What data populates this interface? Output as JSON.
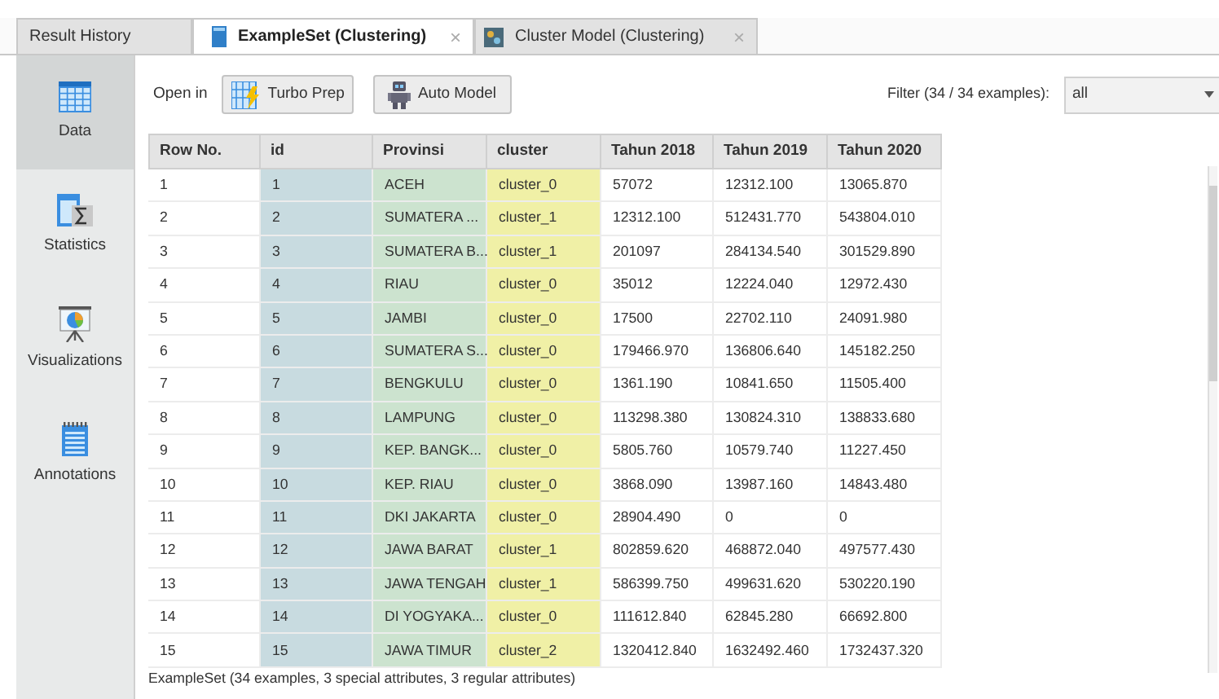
{
  "tabs": [
    {
      "label": "Result History",
      "kind": "plain",
      "selected": false
    },
    {
      "label": "ExampleSet (Clustering)",
      "kind": "table",
      "selected": true,
      "close": "×"
    },
    {
      "label": "Cluster Model (Clustering)",
      "kind": "model",
      "selected": false,
      "close": "×"
    }
  ],
  "sidebar": {
    "items": [
      {
        "label": "Data",
        "kind": "data",
        "selected": true
      },
      {
        "label": "Statistics",
        "kind": "statistics",
        "selected": false
      },
      {
        "label": "Visualizations",
        "kind": "visualizations",
        "selected": false
      },
      {
        "label": "Annotations",
        "kind": "annotations",
        "selected": false
      }
    ]
  },
  "toolbar": {
    "open_in": "Open in",
    "buttons": [
      {
        "label": "Turbo Prep",
        "kind": "turbo"
      },
      {
        "label": "Auto Model",
        "kind": "robot"
      }
    ],
    "filter_label": "Filter (34 / 34 examples):",
    "filter_value": "all"
  },
  "table": {
    "columns": [
      {
        "label": "Row No.",
        "kind": "plain"
      },
      {
        "label": "id",
        "kind": "id"
      },
      {
        "label": "Provinsi",
        "kind": "label"
      },
      {
        "label": "cluster",
        "kind": "cluster"
      },
      {
        "label": "Tahun 2018",
        "kind": "plain"
      },
      {
        "label": "Tahun 2019",
        "kind": "plain"
      },
      {
        "label": "Tahun 2020",
        "kind": "plain"
      }
    ],
    "rows": [
      [
        "1",
        "1",
        "ACEH",
        "cluster_0",
        "57072",
        "12312.100",
        "13065.870"
      ],
      [
        "2",
        "2",
        "SUMATERA ...",
        "cluster_1",
        "12312.100",
        "512431.770",
        "543804.010"
      ],
      [
        "3",
        "3",
        "SUMATERA B...",
        "cluster_1",
        "201097",
        "284134.540",
        "301529.890"
      ],
      [
        "4",
        "4",
        "RIAU",
        "cluster_0",
        "35012",
        "12224.040",
        "12972.430"
      ],
      [
        "5",
        "5",
        "JAMBI",
        "cluster_0",
        "17500",
        "22702.110",
        "24091.980"
      ],
      [
        "6",
        "6",
        "SUMATERA S...",
        "cluster_0",
        "179466.970",
        "136806.640",
        "145182.250"
      ],
      [
        "7",
        "7",
        "BENGKULU",
        "cluster_0",
        "1361.190",
        "10841.650",
        "11505.400"
      ],
      [
        "8",
        "8",
        "LAMPUNG",
        "cluster_0",
        "113298.380",
        "130824.310",
        "138833.680"
      ],
      [
        "9",
        "9",
        "KEP. BANGK...",
        "cluster_0",
        "5805.760",
        "10579.740",
        "11227.450"
      ],
      [
        "10",
        "10",
        "KEP. RIAU",
        "cluster_0",
        "3868.090",
        "13987.160",
        "14843.480"
      ],
      [
        "11",
        "11",
        "DKI JAKARTA",
        "cluster_0",
        "28904.490",
        "0",
        "0"
      ],
      [
        "12",
        "12",
        "JAWA BARAT",
        "cluster_1",
        "802859.620",
        "468872.040",
        "497577.430"
      ],
      [
        "13",
        "13",
        "JAWA TENGAH",
        "cluster_1",
        "586399.750",
        "499631.620",
        "530220.190"
      ],
      [
        "14",
        "14",
        "DI YOGYAKA...",
        "cluster_0",
        "111612.840",
        "62845.280",
        "66692.800"
      ],
      [
        "15",
        "15",
        "JAWA TIMUR",
        "cluster_2",
        "1320412.840",
        "1632492.460",
        "1732437.320"
      ]
    ]
  },
  "status_bar": "ExampleSet (34 examples, 3 special attributes, 3 regular attributes)"
}
